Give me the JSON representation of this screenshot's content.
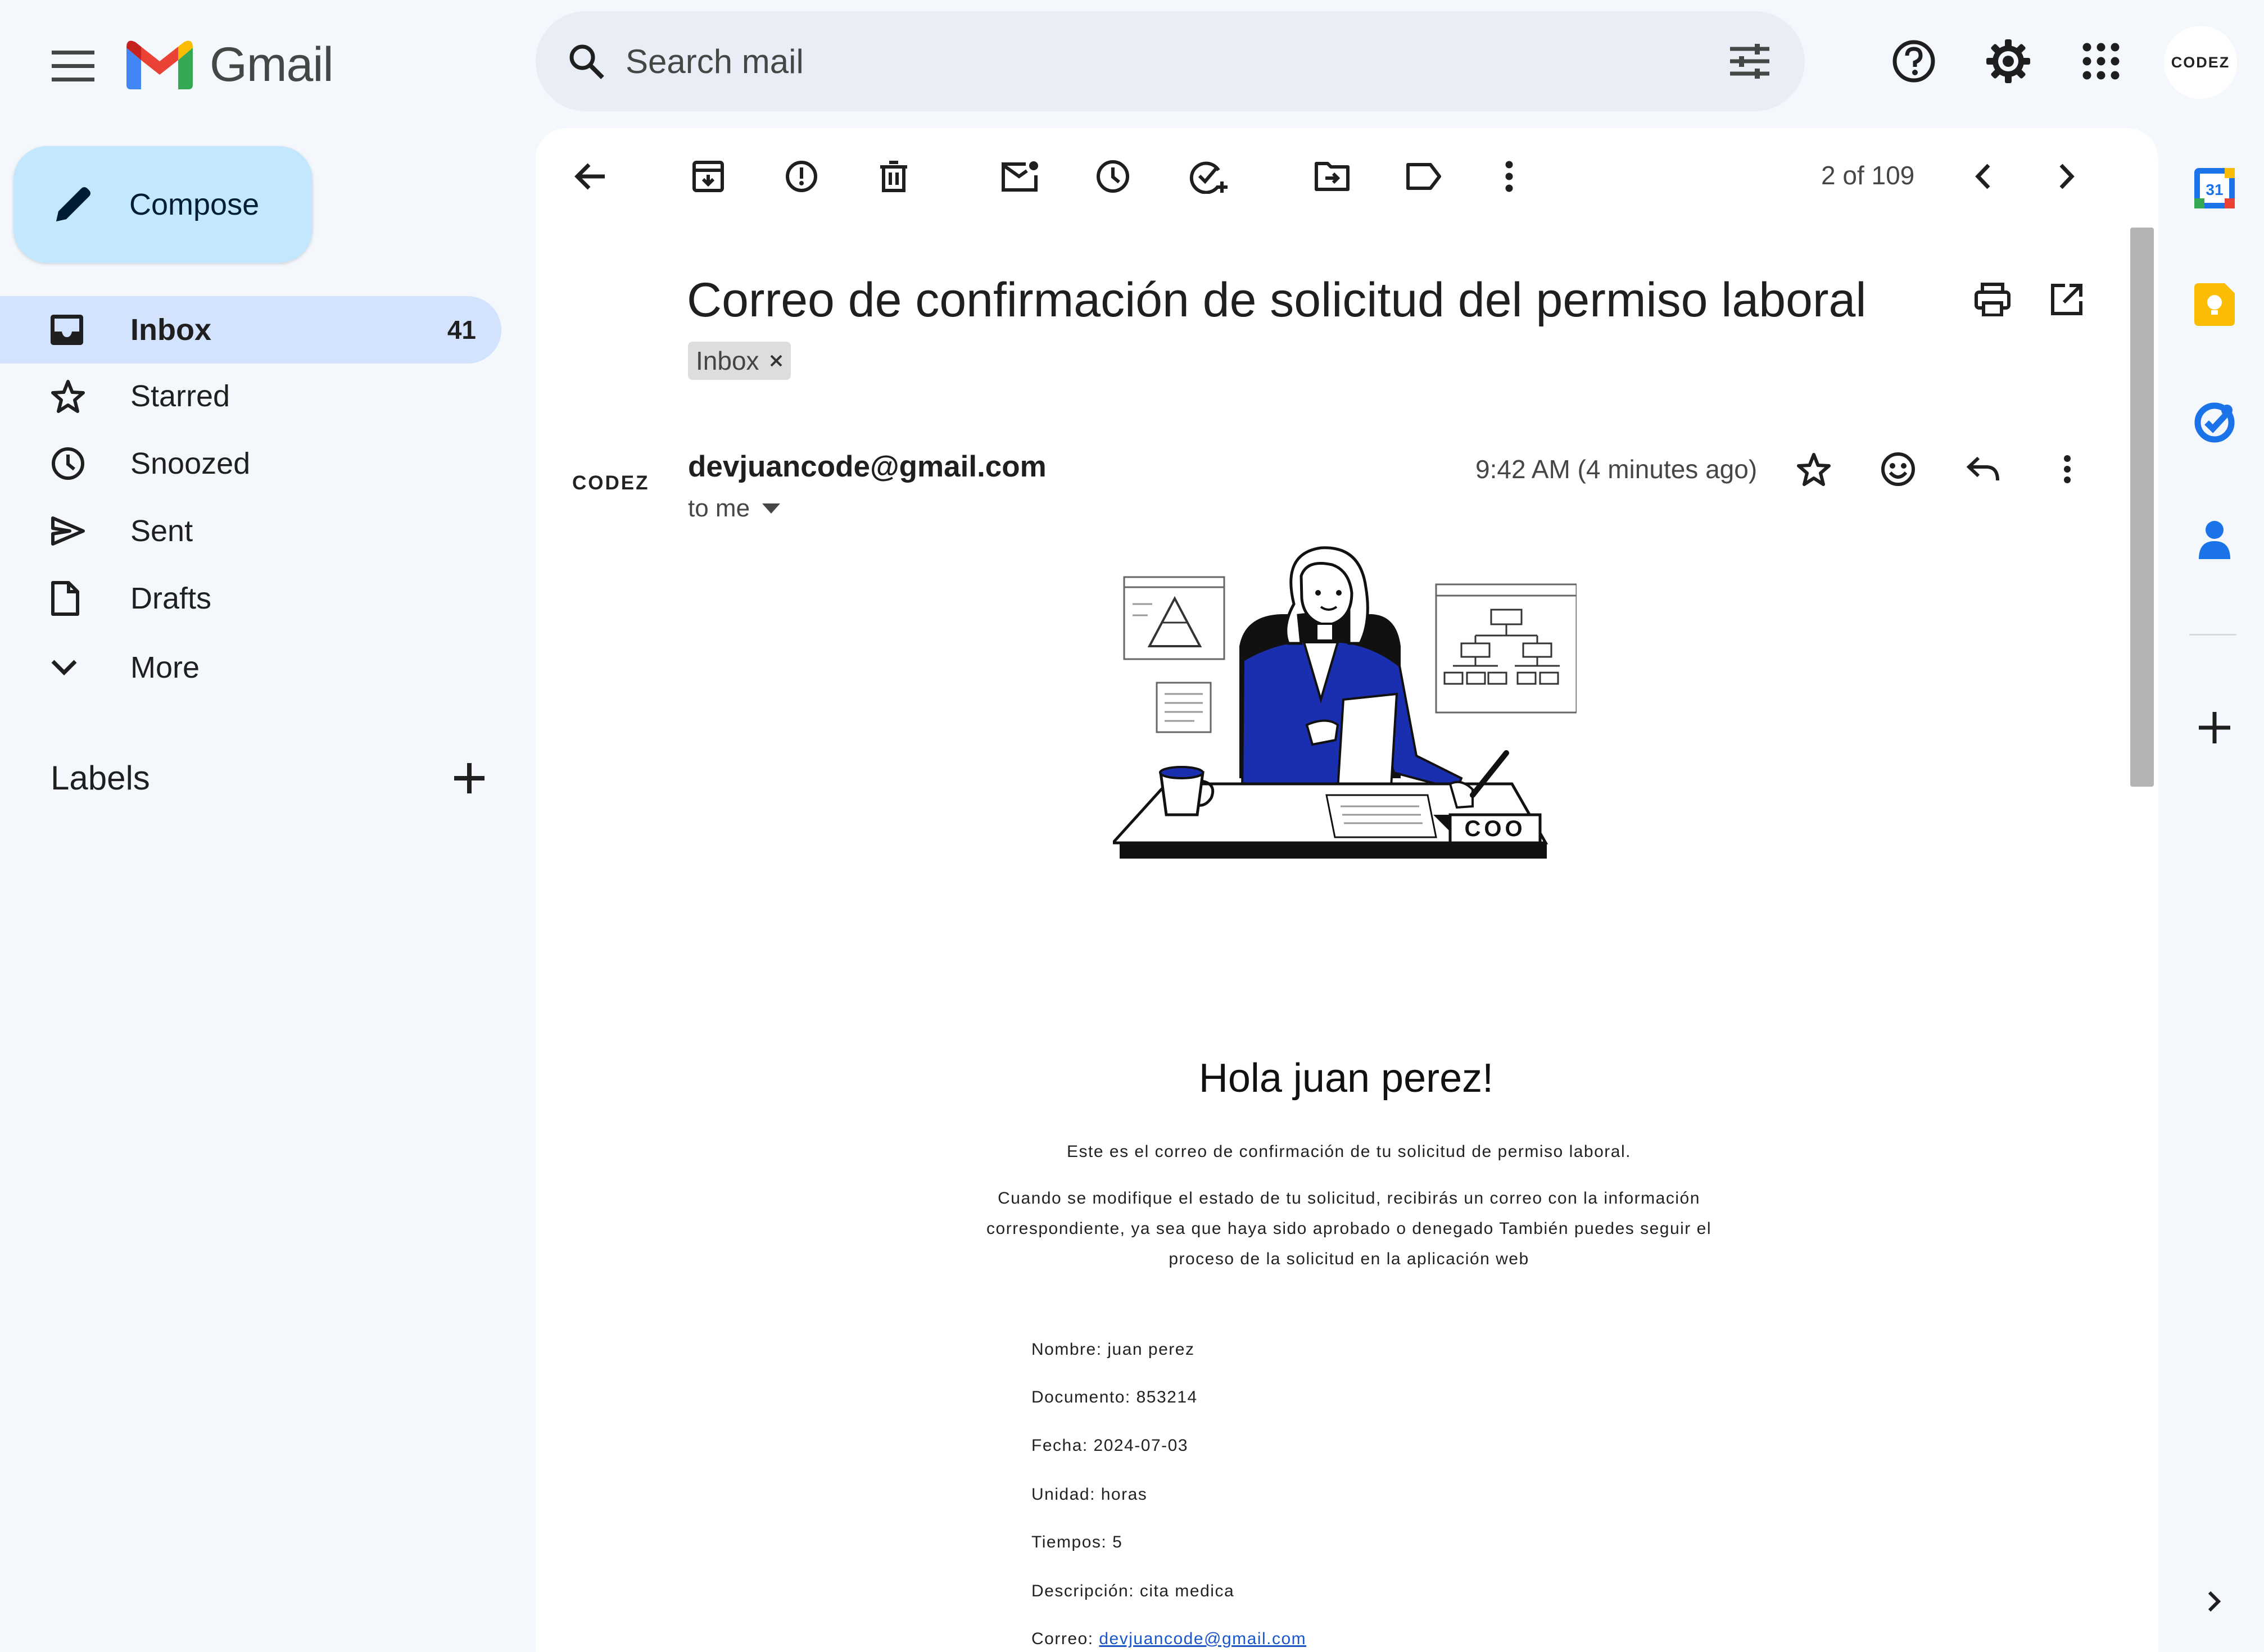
{
  "header": {
    "app_name": "Gmail",
    "search_placeholder": "Search mail",
    "avatar_text": "CODEZ"
  },
  "sidebar": {
    "compose_label": "Compose",
    "items": [
      {
        "label": "Inbox",
        "count": "41",
        "icon": "inbox-icon",
        "active": true
      },
      {
        "label": "Starred",
        "count": "",
        "icon": "star-icon"
      },
      {
        "label": "Snoozed",
        "count": "",
        "icon": "clock-icon"
      },
      {
        "label": "Sent",
        "count": "",
        "icon": "send-icon"
      },
      {
        "label": "Drafts",
        "count": "",
        "icon": "draft-icon"
      },
      {
        "label": "More",
        "count": "",
        "icon": "chevron-down-icon"
      }
    ],
    "labels_title": "Labels"
  },
  "toolbar": {
    "pager_text": "2 of 109"
  },
  "message": {
    "subject": "Correo de confirmación de solicitud del permiso laboral",
    "label_chip": "Inbox",
    "sender_avatar_text": "CODEZ",
    "sender_email": "devjuancode@gmail.com",
    "recipients": "to me",
    "timestamp": "9:42 AM (4 minutes ago)",
    "illustration_text": "COO",
    "greeting": "Hola juan perez!",
    "paragraph_1": "Este es el correo de confirmación de tu solicitud de permiso laboral.",
    "paragraph_2": "Cuando se modifique el estado de tu solicitud, recibirás un correo con la información correspondiente, ya sea que haya sido aprobado o denegado También puedes seguir el proceso de la solicitud en la aplicación web",
    "details": {
      "nombre": "Nombre: juan perez",
      "documento": "Documento: 853214",
      "fecha": "Fecha: 2024-07-03",
      "unidad": "Unidad: horas",
      "tiempos": "Tiempos: 5",
      "descripcion": "Descripción: cita medica",
      "correo_label": "Correo: ",
      "correo_link": "devjuancode@gmail.com"
    }
  },
  "colors": {
    "background": "#f4f8fd",
    "compose": "#c2e7ff",
    "active_nav": "#d3e3fd",
    "illustration_blue": "#1a2fb0"
  }
}
